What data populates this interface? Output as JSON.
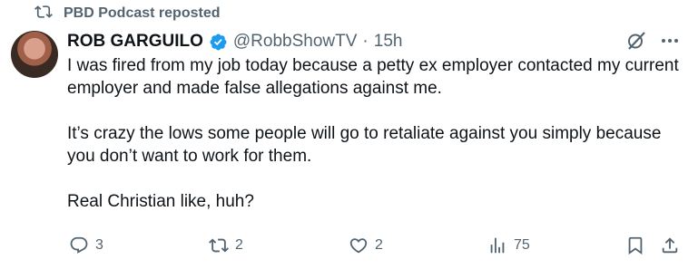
{
  "repost": {
    "label": "PBD Podcast reposted",
    "icon": "repost-icon"
  },
  "author": {
    "name": "ROB GARGUILO",
    "handle": "@RobbShowTV",
    "separator": "·",
    "time": "15h",
    "verified_color": "#1d9bf0"
  },
  "tweet": {
    "paragraphs": [
      "I was fired from my job today because a petty ex employer contacted my current employer and made false allegations against me.",
      "It’s crazy the lows some people will go to retaliate against you simply because you don’t want to work for them.",
      "Real Christian like, huh?"
    ]
  },
  "actions": {
    "replies": "3",
    "reposts": "2",
    "likes": "2",
    "views": "75"
  },
  "colors": {
    "text": "#0f1419",
    "secondary": "#536471",
    "accent": "#1d9bf0"
  }
}
